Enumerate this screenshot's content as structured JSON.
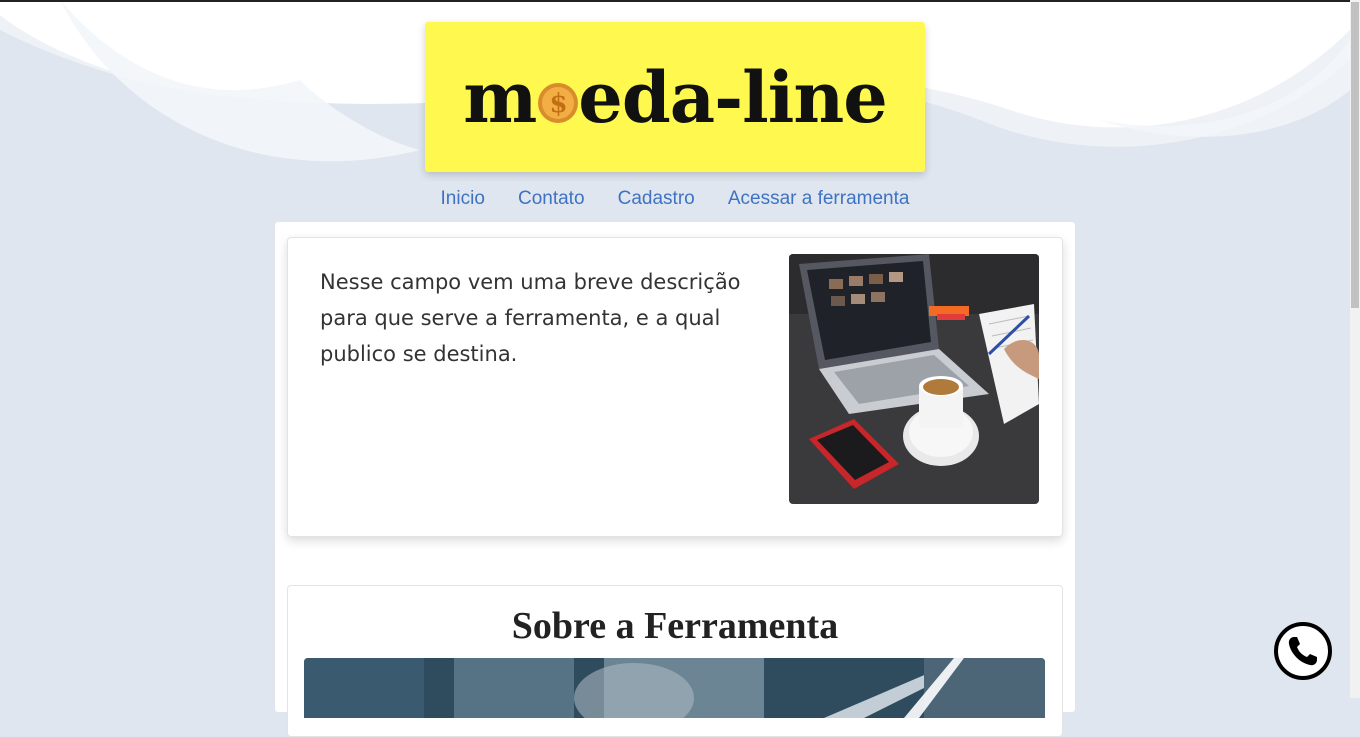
{
  "logo": {
    "text_before": "m",
    "text_after": "eda-line",
    "coin_symbol": "$"
  },
  "nav": {
    "items": [
      {
        "label": "Inicio"
      },
      {
        "label": "Contato"
      },
      {
        "label": "Cadastro"
      },
      {
        "label": "Acessar a ferramenta"
      }
    ]
  },
  "intro": {
    "description_lines": [
      "Nesse campo vem uma breve descrição",
      "para que serve a ferramenta, e a qual",
      "publico se destina."
    ]
  },
  "about": {
    "title": "Sobre a Ferramenta"
  },
  "colors": {
    "background": "#dfe6f0",
    "logo_bg": "#fff94f",
    "nav_link": "#3f73c2",
    "coin": "#e8a33a"
  },
  "icons": {
    "coin": "dollar-coin-icon",
    "phone": "phone-icon"
  }
}
